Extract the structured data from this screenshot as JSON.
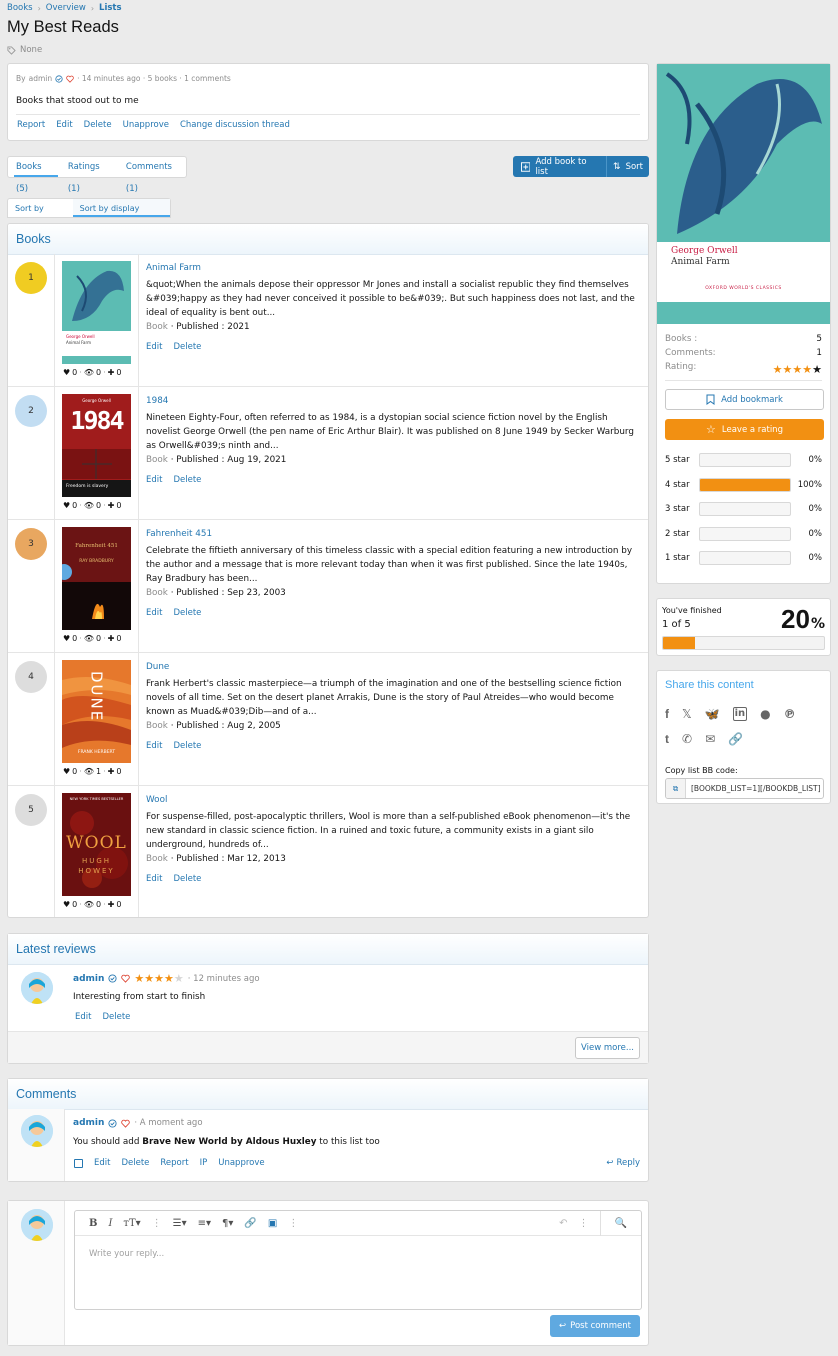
{
  "breadcrumb": {
    "items": [
      "Books",
      "Overview",
      "Lists"
    ]
  },
  "page": {
    "title": "My Best Reads",
    "tag": "None"
  },
  "list_info": {
    "by": "By",
    "author": "admin",
    "meta_rest": "· 14 minutes ago · 5 books · 1 comments",
    "description": "Books that stood out to me",
    "actions": [
      "Report",
      "Edit",
      "Delete",
      "Unapprove",
      "Change discussion thread"
    ]
  },
  "tabs": [
    "Books (5)",
    "Ratings (1)",
    "Comments (1)"
  ],
  "toolbar": {
    "add_book": "Add book to list",
    "sort": "Sort"
  },
  "sort_tabs": [
    "Sort by book",
    "Sort by display order"
  ],
  "books_section": {
    "heading": "Books",
    "items": [
      {
        "rank": "1",
        "rank_color": "#f0cc22",
        "title": "Animal Farm",
        "text": "&quot;When the animals depose their oppressor Mr Jones and install a socialist republic they find themselves &#039;happy as they had never conceived it possible to be&#039;. But such happiness does not last, and the ideal of equality is bent out...",
        "type": "Book",
        "published_label": "Published :",
        "published": "2021",
        "edit": "Edit",
        "delete": "Delete",
        "likes": "0",
        "views": "0",
        "adds": "0"
      },
      {
        "rank": "2",
        "rank_color": "#c2ddf2",
        "title": "1984",
        "text": "Nineteen Eighty-Four, often referred to as 1984, is a dystopian social science fiction novel by the English novelist George Orwell (the pen name of Eric Arthur Blair). It was published on 8 June 1949 by Secker Warburg as Orwell&#039;s ninth and...",
        "type": "Book",
        "published_label": "Published :",
        "published": "Aug 19, 2021",
        "edit": "Edit",
        "delete": "Delete",
        "likes": "0",
        "views": "0",
        "adds": "0"
      },
      {
        "rank": "3",
        "rank_color": "#e8a760",
        "title": "Fahrenheit 451",
        "text": "Celebrate the fiftieth anniversary of this timeless classic with a special edition featuring a new introduction by the author and a message that is more relevant today than when it was first published. Since the late 1940s, Ray Bradbury has been...",
        "type": "Book",
        "published_label": "Published :",
        "published": "Sep 23, 2003",
        "edit": "Edit",
        "delete": "Delete",
        "likes": "0",
        "views": "0",
        "adds": "0"
      },
      {
        "rank": "4",
        "rank_color": "#dddddd",
        "title": "Dune",
        "text": "Frank Herbert's classic masterpiece—a triumph of the imagination and one of the bestselling science fiction novels of all time. Set on the desert planet Arrakis, Dune is the story of Paul Atreides—who would become known as Muad&#039;Dib—and of a...",
        "type": "Book",
        "published_label": "Published :",
        "published": "Aug 2, 2005",
        "edit": "Edit",
        "delete": "Delete",
        "likes": "0",
        "views": "1",
        "adds": "0"
      },
      {
        "rank": "5",
        "rank_color": "#dddddd",
        "title": "Wool",
        "text": "For suspense-filled, post-apocalyptic thrillers, Wool is more than a self-published eBook phenomenon—it's the new standard in classic science fiction. In a ruined and toxic future, a community exists in a giant silo underground, hundreds of...",
        "type": "Book",
        "published_label": "Published :",
        "published": "Mar 12, 2013",
        "edit": "Edit",
        "delete": "Delete",
        "likes": "0",
        "views": "0",
        "adds": "0"
      }
    ]
  },
  "covers": {
    "animal_farm": {
      "author": "George Orwell",
      "title": "Animal Farm"
    },
    "n1984": {
      "title": "1984",
      "sub": "Freedom is slavery",
      "top": "George Orwell"
    },
    "f451": {
      "title": "Fahrenheit 451",
      "author": "RAY BRADBURY"
    },
    "dune": {
      "title": "DUNE",
      "author": "FRANK HERBERT"
    },
    "wool": {
      "title": "WOOL",
      "author1": "HUGH",
      "author2": "HOWEY",
      "top": "NEW YORK TIMES BESTSELLER"
    }
  },
  "reviews": {
    "heading": "Latest reviews",
    "user": "admin",
    "rating": 4,
    "time": "· 12 minutes ago",
    "text": "Interesting from start to finish",
    "edit": "Edit",
    "delete": "Delete",
    "view_more": "View more..."
  },
  "comments": {
    "heading": "Comments",
    "user": "admin",
    "time": "· A moment ago",
    "text_1": "You should add ",
    "text_bold": "Brave New World by Aldous Huxley",
    "text_2": " to this list too",
    "actions": [
      "Edit",
      "Delete",
      "Report",
      "IP",
      "Unapprove"
    ],
    "reply": "Reply"
  },
  "reply_box": {
    "placeholder": "Write your reply...",
    "post": "Post comment"
  },
  "sidebar": {
    "cover": {
      "author": "George Orwell",
      "title": "Animal Farm",
      "series": "OXFORD WORLD'S CLASSICS"
    },
    "books_label": "Books :",
    "books_value": "5",
    "comments_label": "Comments:",
    "comments_value": "1",
    "rating_label": "Rating:",
    "rating_value": 4,
    "bookmark": "Add bookmark",
    "leave_rating": "Leave a rating",
    "breakdown": [
      {
        "label": "5 star",
        "pct": "0%",
        "fraction": 0
      },
      {
        "label": "4 star",
        "pct": "100%",
        "fraction": 1
      },
      {
        "label": "3 star",
        "pct": "0%",
        "fraction": 0
      },
      {
        "label": "2 star",
        "pct": "0%",
        "fraction": 0
      },
      {
        "label": "1 star",
        "pct": "0%",
        "fraction": 0
      }
    ]
  },
  "progress": {
    "label": "You've finished",
    "count": "1 of 5",
    "percent": "20",
    "percent_sign": "%",
    "fraction": 0.2
  },
  "share": {
    "heading": "Share this content",
    "bb_label": "Copy list BB code:",
    "bb_value": "[BOOKDB_LIST=1][/BOOKDB_LIST]"
  },
  "colors": {
    "accent": "#2577b1",
    "orange": "#f29012",
    "link": "#47a7eb"
  }
}
